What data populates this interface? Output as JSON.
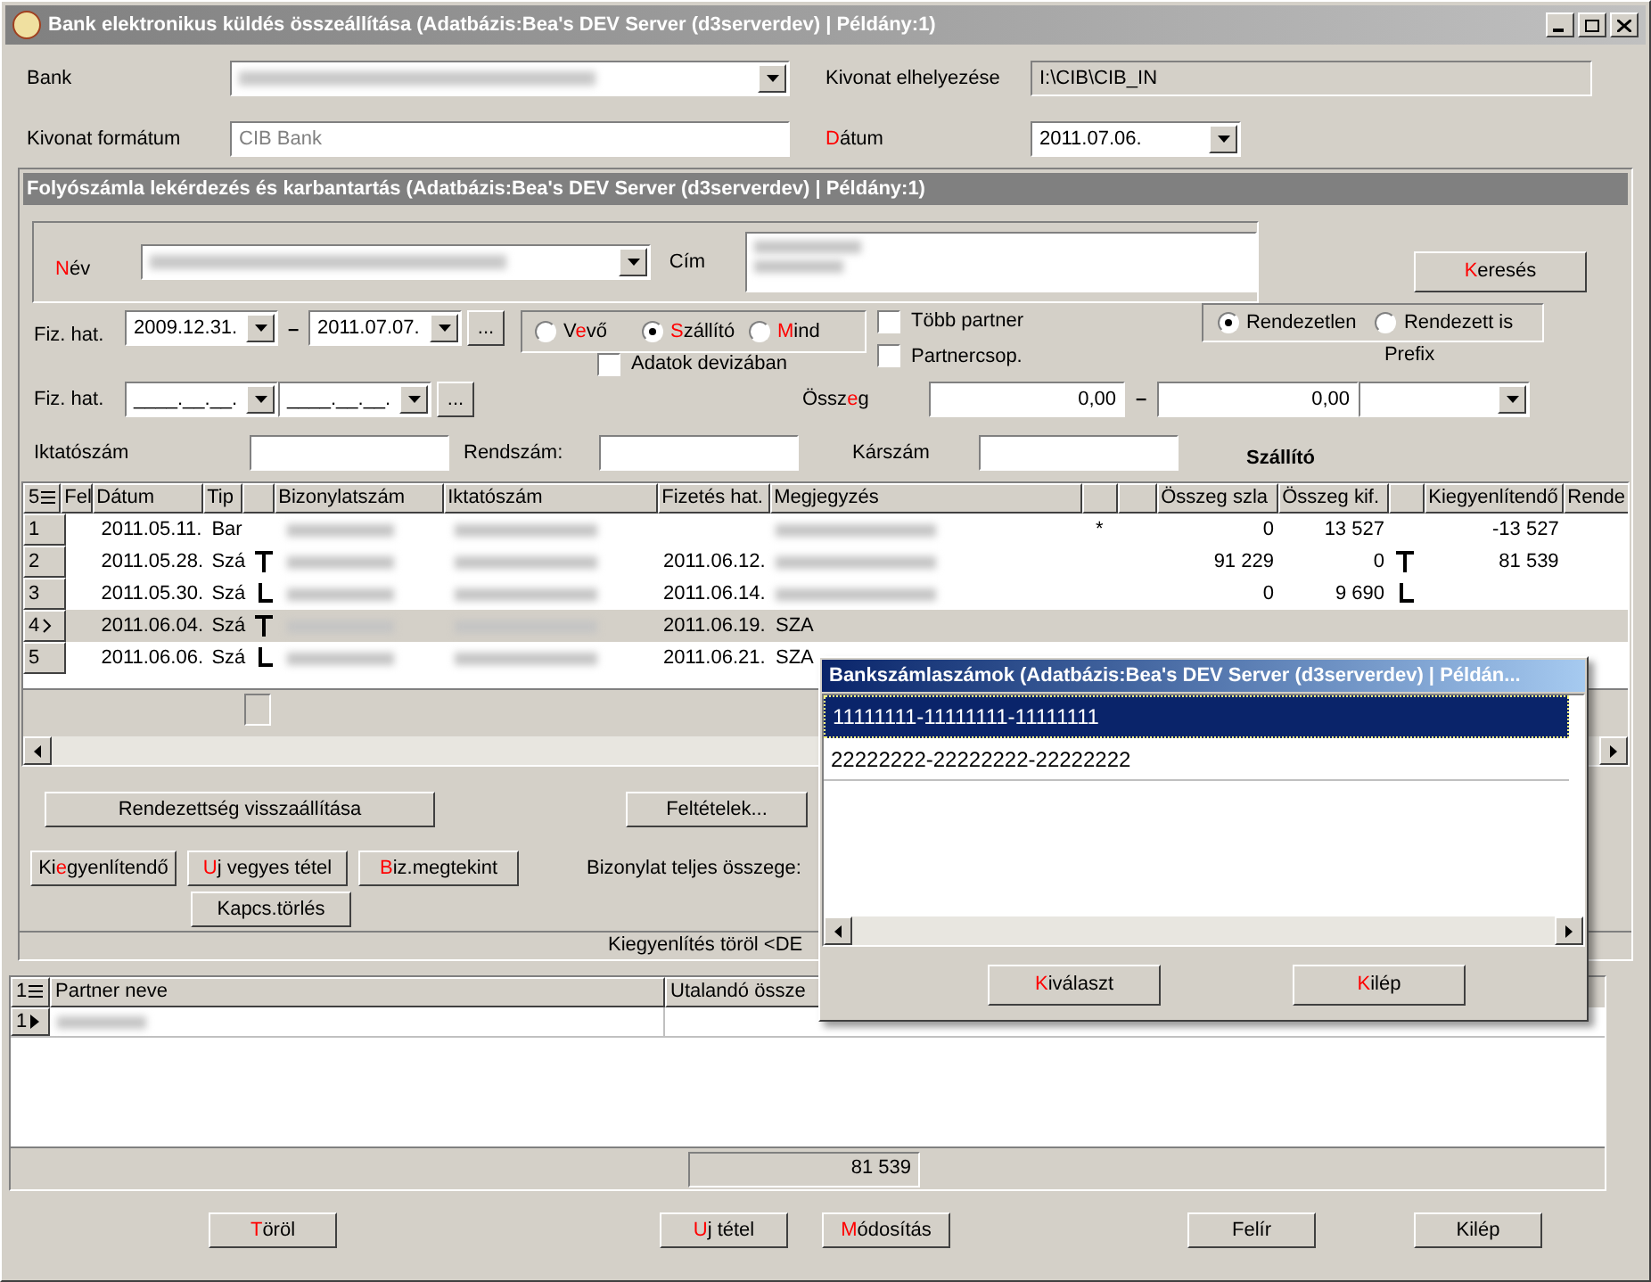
{
  "window": {
    "title": "Bank elektronikus küldés összeállítása  (Adatbázis:Bea's DEV Server (d3serverdev) | Példány:1)"
  },
  "header": {
    "bank_label": "Bank",
    "location_label": "Kivonat elhelyezése",
    "location_value": "I:\\CIB\\CIB_IN",
    "format_label": "Kivonat formátum",
    "format_value": "CIB Bank",
    "date_label": {
      "key": "D",
      "post": "átum"
    },
    "date_value": "2011.07.06."
  },
  "panel": {
    "title": "Folyószámla lekérdezés és karbantartás  (Adatbázis:Bea's DEV Server (d3serverdev) | Példány:1)",
    "name_label": {
      "key": "N",
      "post": "év"
    },
    "address_label": "Cím",
    "search_button": {
      "key": "K",
      "post": "eresés"
    },
    "due_label": "Fiz. hat.",
    "due_from": "2009.12.31.",
    "due_to": "2011.07.07.",
    "dash": "–",
    "ellipsis": "...",
    "partner_radios": [
      {
        "parts": {
          "pre": "V",
          "key": "e",
          "post": "vő"
        },
        "selected": false
      },
      {
        "parts": {
          "key": "S",
          "post": "zállító"
        },
        "selected": true
      },
      {
        "parts": {
          "key": "M",
          "post": "ind"
        },
        "selected": false
      }
    ],
    "checkboxes": [
      {
        "label": "Több partner",
        "checked": false
      },
      {
        "label": "Partnercsop.",
        "checked": false
      }
    ],
    "order_radios": [
      {
        "label": "Rendezetlen",
        "selected": true
      },
      {
        "label": "Rendezett is",
        "selected": false
      }
    ],
    "currency_checkbox": {
      "label": "Adatok devizában",
      "checked": false
    },
    "prefix_label": "Prefix",
    "due2_label": "Fiz. hat.",
    "due2_from": "____.__.__.",
    "due2_to": "____.__.__.",
    "amount_label": {
      "pre": "Össz",
      "key": "e",
      "post": "g"
    },
    "amount_from": "0,00",
    "amount_to": "0,00",
    "filing_label": "Iktatószám",
    "plate_label": "Rendszám:",
    "claim_label": "Kárszám",
    "grid_heading": "Szállító"
  },
  "grid": {
    "count": "5",
    "columns": [
      "Fel",
      "Dátum",
      "Tip",
      "Bizonylatszám",
      "Iktatószám",
      "Fizetés hat.",
      "Megjegyzés",
      "Összeg szla",
      "Összeg kif.",
      "Kiegyenlítendő",
      "Rende"
    ],
    "rows": [
      {
        "number": "1",
        "date": "2011.05.11.",
        "type": "Bar",
        "note": "",
        "star": "*",
        "invoice_sum": "0",
        "paid_sum": "13 527",
        "balance": "-13 527",
        "link_top": false,
        "link_bottom": false,
        "paid_link_top": false,
        "paid_link_bottom": false,
        "selected": false
      },
      {
        "number": "2",
        "date": "2011.05.28.",
        "type": "Szá",
        "due": "2011.06.12.",
        "note": "",
        "invoice_sum": "91 229",
        "paid_sum": "0",
        "balance": "81 539",
        "link_top": true,
        "link_bottom": false,
        "paid_link_top": true,
        "paid_link_bottom": false,
        "selected": false
      },
      {
        "number": "3",
        "date": "2011.05.30.",
        "type": "Szá",
        "due": "2011.06.14.",
        "note": "",
        "invoice_sum": "0",
        "paid_sum": "9 690",
        "link_top": false,
        "link_bottom": true,
        "paid_link_top": false,
        "paid_link_bottom": true,
        "selected": false
      },
      {
        "number": "4",
        "date": "2011.06.04.",
        "type": "Szá",
        "due": "2011.06.19.",
        "note": "SZA",
        "link_top": true,
        "link_bottom": false,
        "paid_link_top": false,
        "paid_link_bottom": false,
        "selected": true
      },
      {
        "number": "5",
        "date": "2011.06.06.",
        "type": "Szá",
        "due": "2011.06.21.",
        "note": "SZA",
        "link_top": false,
        "link_bottom": true,
        "paid_link_top": false,
        "paid_link_bottom": false,
        "selected": false
      }
    ]
  },
  "actions": {
    "reset_button": "Rendezettség visszaállítása",
    "conditions_button": "Feltételek...",
    "row_buttons": [
      {
        "pre": "Ki",
        "key": "e",
        "post": "gyenlítendő"
      },
      {
        "key": "U",
        "post": "j vegyes tétel"
      },
      {
        "key": "B",
        "post": "iz.megtekint"
      }
    ],
    "unlink_button": "Kapcs.törlés",
    "total_label": "Bizonylat teljes összege:",
    "status": "Kiegyenlítés töröl <DE"
  },
  "popup": {
    "title": "Bankszámlaszámok  (Adatbázis:Bea's DEV Server (d3serverdev) | Példán...",
    "items": [
      {
        "label": "11111111-11111111-11111111",
        "selected": true
      },
      {
        "label": "22222222-22222222-22222222",
        "selected": false
      }
    ],
    "buttons": [
      {
        "key": "K",
        "post": "iválaszt"
      },
      {
        "key": "K",
        "post": "ilép"
      }
    ]
  },
  "partners": {
    "count": "1",
    "columns": [
      "Partner neve",
      "Utalandó össze"
    ],
    "rows": [
      {
        "number": "1",
        "current": true
      }
    ],
    "total": "81 539"
  },
  "footer_buttons": [
    {
      "key": "T",
      "post": "öröl"
    },
    {
      "key": "U",
      "post": "j tétel"
    },
    {
      "key": "M",
      "post": "ódosítás"
    },
    {
      "pre": "Felír"
    },
    {
      "pre": "Kilép"
    }
  ]
}
